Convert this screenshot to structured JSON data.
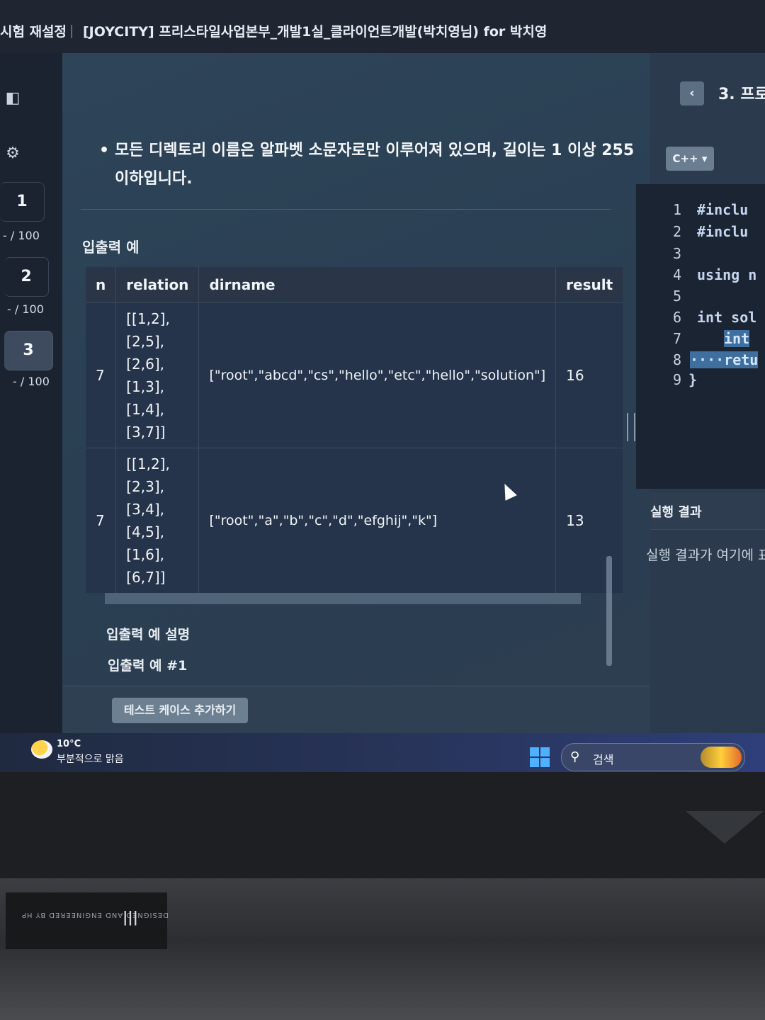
{
  "header": {
    "breadcrumb": "시험 재설정",
    "separator": "|",
    "title": "[JOYCITY] 프리스타일사업본부_개발1실_클라이언트개발(박치영님) for 박치영"
  },
  "rail": {
    "problems": [
      {
        "number": "1",
        "score": "- / 100"
      },
      {
        "number": "2",
        "score": "- / 100"
      },
      {
        "number": "3",
        "score": "- / 100"
      }
    ]
  },
  "problem": {
    "bullet": "모든 디렉토리 이름은 알파벳 소문자로만 이루어져 있으며, 길이는 1 이상 255 이하입니다.",
    "section_heading": "입출력 예",
    "table": {
      "headers": [
        "n",
        "relation",
        "dirname",
        "result"
      ],
      "rows": [
        {
          "n": "7",
          "relation": [
            "[[1,2],",
            "[2,5],",
            "[2,6],",
            "[1,3],",
            "[1,4],",
            "[3,7]]"
          ],
          "dirname": "[\"root\",\"abcd\",\"cs\",\"hello\",\"etc\",\"hello\",\"solution\"]",
          "result": "16"
        },
        {
          "n": "7",
          "relation": [
            "[[1,2],",
            "[2,3],",
            "[3,4],",
            "[4,5],",
            "[1,6],",
            "[6,7]]"
          ],
          "dirname": "[\"root\",\"a\",\"b\",\"c\",\"d\",\"efghij\",\"k\"]",
          "result": "13"
        }
      ]
    },
    "explanation_heading": "입출력 예 설명",
    "example_heading": "입출력 예 #1",
    "add_testcase_button": "테스트 케이스 추가하기"
  },
  "right_panel": {
    "back_icon": "chevron-left-icon",
    "problem_title": "3. 프로",
    "language": "C++ ▾",
    "code_lines": [
      {
        "n": "1",
        "text": "#inclu"
      },
      {
        "n": "2",
        "text": "#inclu"
      },
      {
        "n": "3",
        "text": ""
      },
      {
        "n": "4",
        "text": "using n"
      },
      {
        "n": "5",
        "text": ""
      },
      {
        "n": "6",
        "text": "int sol"
      },
      {
        "n": "7",
        "text": "int"
      },
      {
        "n": "8",
        "text": "····retu"
      },
      {
        "n": "9",
        "text": "}"
      }
    ],
    "run_heading": "실행 결과",
    "run_placeholder": "실행 결과가 여기에 표"
  },
  "taskbar": {
    "temperature": "10°C",
    "weather": "부분적으로 맑음",
    "search_label": "검색"
  },
  "laptop": {
    "label_text": "DESIGNED AND ENGINEERED BY HP"
  },
  "colors": {
    "accent": "#3f6f9f",
    "panel": "#2a3f52",
    "button": "#6d8092"
  }
}
